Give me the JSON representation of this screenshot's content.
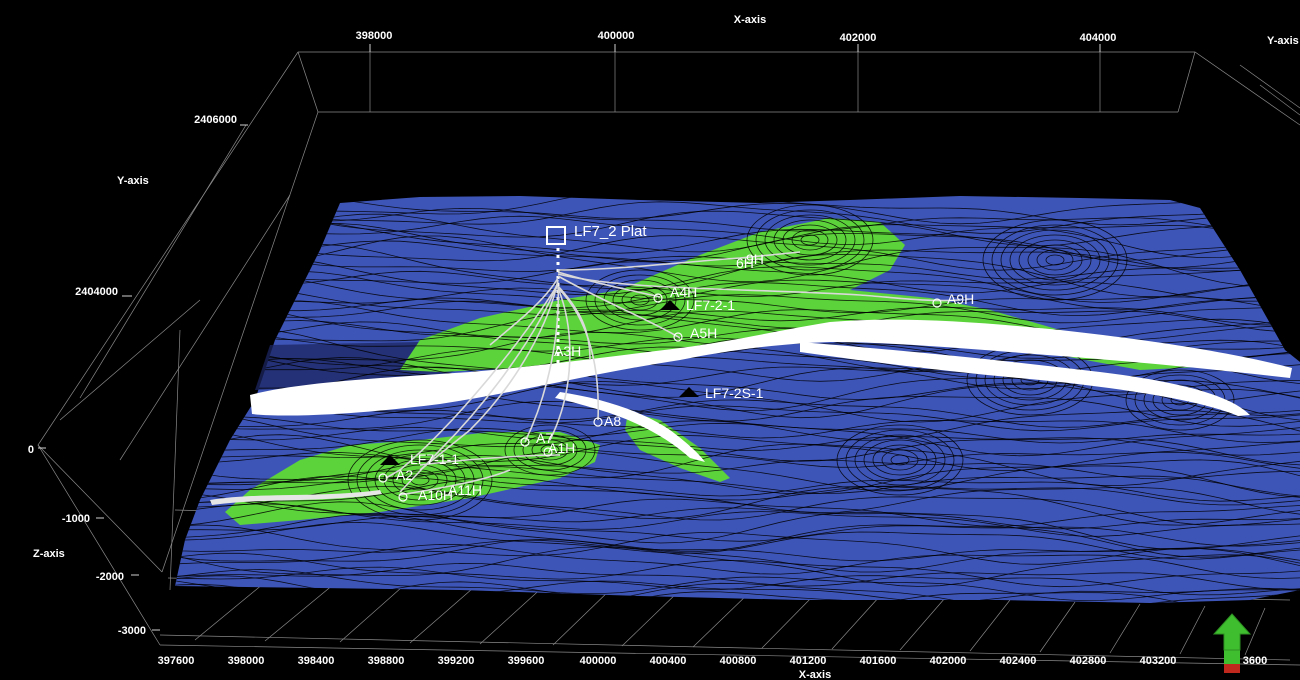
{
  "axes": {
    "x_title_top": "X-axis",
    "x_title_bottom": "X-axis",
    "y_title_left": "Y-axis",
    "y_title_right": "Y-axis",
    "z_title": "Z-axis",
    "top_x_ticks": [
      "398000",
      "400000",
      "402000",
      "404000"
    ],
    "y_ticks": [
      "2406000",
      "2404000"
    ],
    "z_ticks": [
      "0",
      "-1000",
      "-2000",
      "-3000"
    ],
    "bottom_x_ticks": [
      "397600",
      "398000",
      "398400",
      "398800",
      "399200",
      "399600",
      "400000",
      "400400",
      "400800",
      "401200",
      "401600",
      "402000",
      "402400",
      "402800",
      "403200",
      "3600"
    ]
  },
  "platform": {
    "label": "LF7_2 Plat"
  },
  "wells": {
    "w6h": "6H",
    "w9h": "9H",
    "a4h": "A4H",
    "lf7_2_1": "LF7-2-1",
    "a9h": "A9H",
    "a5h": "A5H",
    "a3h": "A3H",
    "lf7_2s_1": "LF7-2S-1",
    "a8": "A8",
    "a7": "A7",
    "a1h": "A1H",
    "lf_1_1": "LF7-1-1",
    "a2": "A2",
    "a10h": "A10H",
    "a11h": "A11H"
  },
  "colors": {
    "background": "#000000",
    "surface_blue": "#3e55b8",
    "surface_green": "#5cd33a",
    "fault_white": "#ffffff",
    "grid": "#8a8a8a",
    "nav_arrow": "#3fbf2f",
    "nav_base_red": "#c0281e"
  },
  "icons": {
    "nav": "navigation-arrow-icon",
    "platform": "platform-square-icon",
    "well_marker": "well-triangle-icon"
  }
}
